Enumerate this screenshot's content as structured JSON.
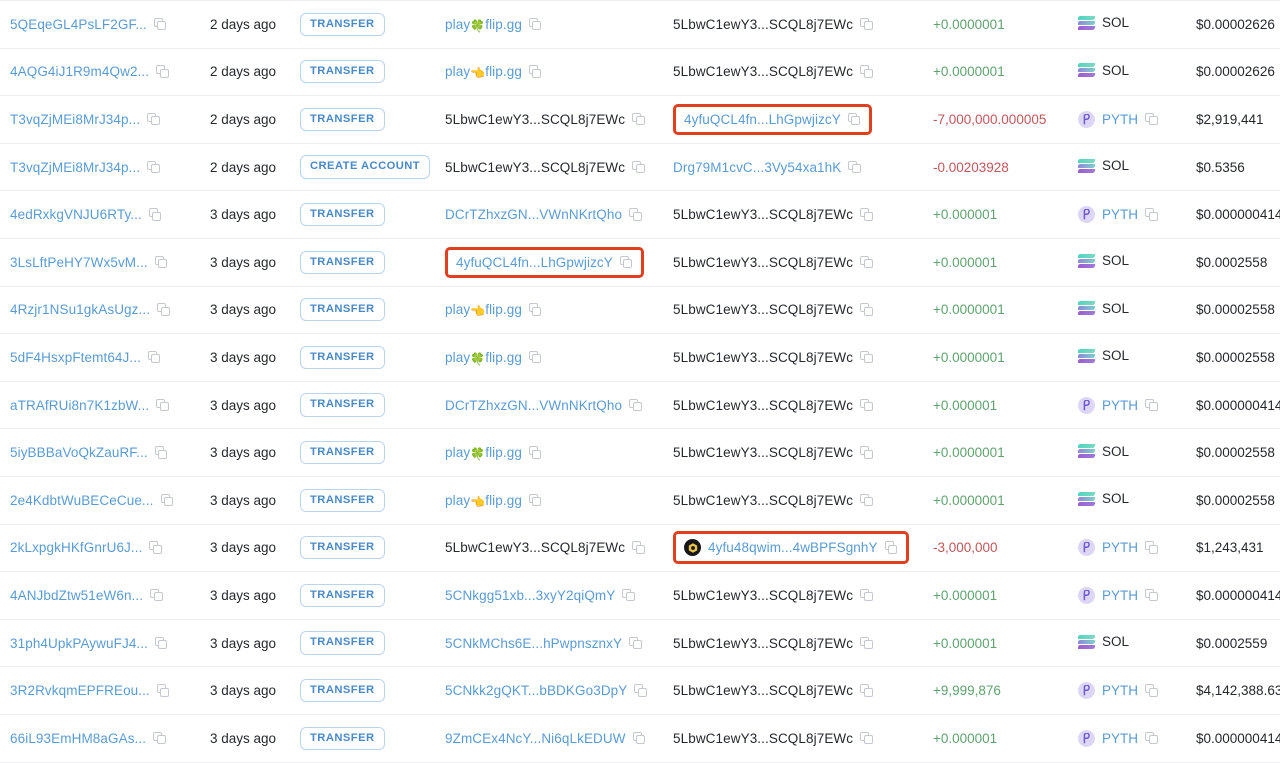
{
  "meta": {
    "view": "solana-explorer-account-transfers-table",
    "colors": {
      "link": "#5b9bd5",
      "positive": "#60a36f",
      "negative": "#c0585a",
      "badge_border": "#b9d5ee",
      "badge_text": "#4a89c8",
      "highlight": "#e0401f",
      "row_divider": "#eceef1"
    },
    "icons": {
      "copy": "copy-icon",
      "sol": "sol-token-icon",
      "pyth": "pyth-token-icon",
      "avatar": "token-avatar-icon",
      "clover": "🍀",
      "hand": "👈"
    }
  },
  "rows": [
    {
      "signature": "5QEqeGL4PsLF2GF...",
      "age": "2 days ago",
      "type": "TRANSFER",
      "from": {
        "text_before": "play",
        "emoji": "🍀",
        "text_after": "flip.gg",
        "link": true,
        "copy": true,
        "highlight": false,
        "avatar": false
      },
      "to": {
        "text": "5LbwC1ewY3...SCQL8j7EWc",
        "link": false,
        "copy": true,
        "highlight": false,
        "avatar": false
      },
      "amount": "+0.0000001",
      "amount_sign": "pos",
      "token": "SOL",
      "token_icon": "sol",
      "token_copy": false,
      "value": "$0.00002626"
    },
    {
      "signature": "4AQG4iJ1R9m4Qw2...",
      "age": "2 days ago",
      "type": "TRANSFER",
      "from": {
        "text_before": "play",
        "emoji": "👈",
        "text_after": "flip.gg",
        "link": true,
        "copy": true,
        "highlight": false,
        "avatar": false
      },
      "to": {
        "text": "5LbwC1ewY3...SCQL8j7EWc",
        "link": false,
        "copy": true,
        "highlight": false,
        "avatar": false
      },
      "amount": "+0.0000001",
      "amount_sign": "pos",
      "token": "SOL",
      "token_icon": "sol",
      "token_copy": false,
      "value": "$0.00002626"
    },
    {
      "signature": "T3vqZjMEi8MrJ34p...",
      "age": "2 days ago",
      "type": "TRANSFER",
      "from": {
        "text": "5LbwC1ewY3...SCQL8j7EWc",
        "link": false,
        "copy": true,
        "highlight": false,
        "avatar": false
      },
      "to": {
        "text": "4yfuQCL4fn...LhGpwjizcY",
        "link": true,
        "copy": true,
        "highlight": true,
        "avatar": false
      },
      "amount": "-7,000,000.000005",
      "amount_sign": "neg",
      "token": "PYTH",
      "token_icon": "pyth",
      "token_copy": true,
      "value": "$2,919,441"
    },
    {
      "signature": "T3vqZjMEi8MrJ34p...",
      "age": "2 days ago",
      "type": "CREATE ACCOUNT",
      "from": {
        "text": "5LbwC1ewY3...SCQL8j7EWc",
        "link": false,
        "copy": true,
        "highlight": false,
        "avatar": false
      },
      "to": {
        "text": "Drg79M1cvC...3Vy54xa1hK",
        "link": true,
        "copy": true,
        "highlight": false,
        "avatar": false
      },
      "amount": "-0.00203928",
      "amount_sign": "neg",
      "token": "SOL",
      "token_icon": "sol",
      "token_copy": false,
      "value": "$0.5356"
    },
    {
      "signature": "4edRxkgVNJU6RTy...",
      "age": "3 days ago",
      "type": "TRANSFER",
      "from": {
        "text": "DCrTZhxzGN...VWnNKrtQho",
        "link": true,
        "copy": true,
        "highlight": false,
        "avatar": false
      },
      "to": {
        "text": "5LbwC1ewY3...SCQL8j7EWc",
        "link": false,
        "copy": true,
        "highlight": false,
        "avatar": false
      },
      "amount": "+0.000001",
      "amount_sign": "pos",
      "token": "PYTH",
      "token_icon": "pyth",
      "token_copy": true,
      "value": "$0.000000414"
    },
    {
      "signature": "3LsLftPeHY7Wx5vM...",
      "age": "3 days ago",
      "type": "TRANSFER",
      "from": {
        "text": "4yfuQCL4fn...LhGpwjizcY",
        "link": true,
        "copy": true,
        "highlight": true,
        "avatar": false
      },
      "to": {
        "text": "5LbwC1ewY3...SCQL8j7EWc",
        "link": false,
        "copy": true,
        "highlight": false,
        "avatar": false
      },
      "amount": "+0.000001",
      "amount_sign": "pos",
      "token": "SOL",
      "token_icon": "sol",
      "token_copy": false,
      "value": "$0.0002558"
    },
    {
      "signature": "4Rzjr1NSu1gkAsUgz...",
      "age": "3 days ago",
      "type": "TRANSFER",
      "from": {
        "text_before": "play",
        "emoji": "👈",
        "text_after": "flip.gg",
        "link": true,
        "copy": true,
        "highlight": false,
        "avatar": false
      },
      "to": {
        "text": "5LbwC1ewY3...SCQL8j7EWc",
        "link": false,
        "copy": true,
        "highlight": false,
        "avatar": false
      },
      "amount": "+0.0000001",
      "amount_sign": "pos",
      "token": "SOL",
      "token_icon": "sol",
      "token_copy": false,
      "value": "$0.00002558"
    },
    {
      "signature": "5dF4HsxpFtemt64J...",
      "age": "3 days ago",
      "type": "TRANSFER",
      "from": {
        "text_before": "play",
        "emoji": "🍀",
        "text_after": "flip.gg",
        "link": true,
        "copy": true,
        "highlight": false,
        "avatar": false
      },
      "to": {
        "text": "5LbwC1ewY3...SCQL8j7EWc",
        "link": false,
        "copy": true,
        "highlight": false,
        "avatar": false
      },
      "amount": "+0.0000001",
      "amount_sign": "pos",
      "token": "SOL",
      "token_icon": "sol",
      "token_copy": false,
      "value": "$0.00002558"
    },
    {
      "signature": "aTRAfRUi8n7K1zbW...",
      "age": "3 days ago",
      "type": "TRANSFER",
      "from": {
        "text": "DCrTZhxzGN...VWnNKrtQho",
        "link": true,
        "copy": true,
        "highlight": false,
        "avatar": false
      },
      "to": {
        "text": "5LbwC1ewY3...SCQL8j7EWc",
        "link": false,
        "copy": true,
        "highlight": false,
        "avatar": false
      },
      "amount": "+0.000001",
      "amount_sign": "pos",
      "token": "PYTH",
      "token_icon": "pyth",
      "token_copy": true,
      "value": "$0.000000414"
    },
    {
      "signature": "5iyBBBaVoQkZauRF...",
      "age": "3 days ago",
      "type": "TRANSFER",
      "from": {
        "text_before": "play",
        "emoji": "🍀",
        "text_after": "flip.gg",
        "link": true,
        "copy": true,
        "highlight": false,
        "avatar": false
      },
      "to": {
        "text": "5LbwC1ewY3...SCQL8j7EWc",
        "link": false,
        "copy": true,
        "highlight": false,
        "avatar": false
      },
      "amount": "+0.0000001",
      "amount_sign": "pos",
      "token": "SOL",
      "token_icon": "sol",
      "token_copy": false,
      "value": "$0.00002558"
    },
    {
      "signature": "2e4KdbtWuBECeCue...",
      "age": "3 days ago",
      "type": "TRANSFER",
      "from": {
        "text_before": "play",
        "emoji": "👈",
        "text_after": "flip.gg",
        "link": true,
        "copy": true,
        "highlight": false,
        "avatar": false
      },
      "to": {
        "text": "5LbwC1ewY3...SCQL8j7EWc",
        "link": false,
        "copy": true,
        "highlight": false,
        "avatar": false
      },
      "amount": "+0.0000001",
      "amount_sign": "pos",
      "token": "SOL",
      "token_icon": "sol",
      "token_copy": false,
      "value": "$0.00002558"
    },
    {
      "signature": "2kLxpgkHKfGnrU6J...",
      "age": "3 days ago",
      "type": "TRANSFER",
      "from": {
        "text": "5LbwC1ewY3...SCQL8j7EWc",
        "link": false,
        "copy": true,
        "highlight": false,
        "avatar": false
      },
      "to": {
        "text": "4yfu48qwim...4wBPFSgnhY",
        "link": true,
        "copy": true,
        "highlight": true,
        "avatar": true
      },
      "amount": "-3,000,000",
      "amount_sign": "neg",
      "token": "PYTH",
      "token_icon": "pyth",
      "token_copy": true,
      "value": "$1,243,431"
    },
    {
      "signature": "4ANJbdZtw51eW6n...",
      "age": "3 days ago",
      "type": "TRANSFER",
      "from": {
        "text": "5CNkgg51xb...3xyY2qiQmY",
        "link": true,
        "copy": true,
        "highlight": false,
        "avatar": false
      },
      "to": {
        "text": "5LbwC1ewY3...SCQL8j7EWc",
        "link": false,
        "copy": true,
        "highlight": false,
        "avatar": false
      },
      "amount": "+0.000001",
      "amount_sign": "pos",
      "token": "PYTH",
      "token_icon": "pyth",
      "token_copy": true,
      "value": "$0.000000414"
    },
    {
      "signature": "31ph4UpkPAywuFJ4...",
      "age": "3 days ago",
      "type": "TRANSFER",
      "from": {
        "text": "5CNkMChs6E...hPwpnsznxY",
        "link": true,
        "copy": true,
        "highlight": false,
        "avatar": false
      },
      "to": {
        "text": "5LbwC1ewY3...SCQL8j7EWc",
        "link": false,
        "copy": true,
        "highlight": false,
        "avatar": false
      },
      "amount": "+0.000001",
      "amount_sign": "pos",
      "token": "SOL",
      "token_icon": "sol",
      "token_copy": false,
      "value": "$0.0002559"
    },
    {
      "signature": "3R2RvkqmEPFREou...",
      "age": "3 days ago",
      "type": "TRANSFER",
      "from": {
        "text": "5CNkk2gQKT...bBDKGo3DpY",
        "link": true,
        "copy": true,
        "highlight": false,
        "avatar": false
      },
      "to": {
        "text": "5LbwC1ewY3...SCQL8j7EWc",
        "link": false,
        "copy": true,
        "highlight": false,
        "avatar": false
      },
      "amount": "+9,999,876",
      "amount_sign": "pos",
      "token": "PYTH",
      "token_icon": "pyth",
      "token_copy": true,
      "value": "$4,142,388.63"
    },
    {
      "signature": "66iL93EmHM8aGAs...",
      "age": "3 days ago",
      "type": "TRANSFER",
      "from": {
        "text": "9ZmCEx4NcY...Ni6qLkEDUW",
        "link": true,
        "copy": true,
        "highlight": false,
        "avatar": false
      },
      "to": {
        "text": "5LbwC1ewY3...SCQL8j7EWc",
        "link": false,
        "copy": true,
        "highlight": false,
        "avatar": false
      },
      "amount": "+0.000001",
      "amount_sign": "pos",
      "token": "PYTH",
      "token_icon": "pyth",
      "token_copy": true,
      "value": "$0.000000414"
    }
  ]
}
